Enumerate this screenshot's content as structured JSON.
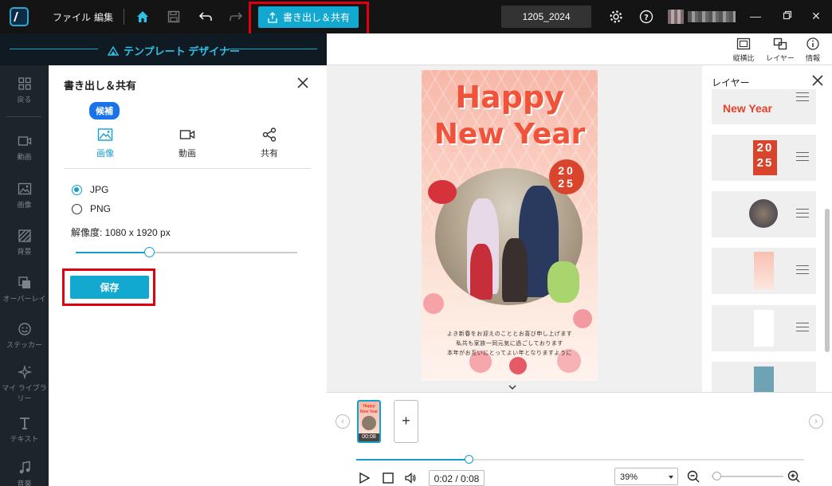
{
  "menu": {
    "file": "ファイル",
    "edit": "編集"
  },
  "toolbar": {
    "export_share": "書き出し＆共有"
  },
  "project": {
    "name": "1205_2024"
  },
  "designer": {
    "title": "テンプレート デザイナー"
  },
  "sidebar": {
    "items": [
      {
        "label": "戻る",
        "icon": "grid-icon"
      },
      {
        "label": "動画",
        "icon": "video-icon"
      },
      {
        "label": "画像",
        "icon": "image-icon"
      },
      {
        "label": "背景",
        "icon": "background-icon"
      },
      {
        "label": "オーバーレイ",
        "icon": "overlay-icon"
      },
      {
        "label": "ステッカー",
        "icon": "sticker-icon"
      },
      {
        "label": "マイ ライブラリー",
        "icon": "sparkle-icon"
      },
      {
        "label": "テキスト",
        "icon": "text-icon"
      },
      {
        "label": "音楽",
        "icon": "music-icon"
      }
    ]
  },
  "export_panel": {
    "title": "書き出し＆共有",
    "badge": "候補",
    "tabs": [
      {
        "label": "画像",
        "active": true
      },
      {
        "label": "動画",
        "active": false
      },
      {
        "label": "共有",
        "active": false
      }
    ],
    "formats": [
      {
        "label": "JPG",
        "checked": true
      },
      {
        "label": "PNG",
        "checked": false
      }
    ],
    "resolution_label": "解像度: 1080 x 1920 px",
    "resolution_level": 0.33,
    "save_label": "保存"
  },
  "canvas_tools": [
    {
      "label": "縦横比",
      "icon": "aspect-ratio-icon"
    },
    {
      "label": "レイヤー",
      "icon": "layers-icon"
    },
    {
      "label": "情報",
      "icon": "info-icon"
    }
  ],
  "card": {
    "line1": "Happy",
    "line2": "New Year",
    "year_top": "20",
    "year_bottom": "25",
    "message": [
      "よき新春をお迎えのこととお喜び申し上げます",
      "私共も家族一同元気に過ごしております",
      "本年がお互いにとってよい年となりますように"
    ]
  },
  "layers": {
    "title": "レイヤー",
    "items": [
      {
        "text": "New Year"
      },
      {
        "text_top": "20",
        "text_bottom": "25"
      },
      {
        "kind": "photo"
      },
      {
        "kind": "background"
      },
      {
        "kind": "white"
      },
      {
        "kind": "blue"
      }
    ]
  },
  "timeline": {
    "clip_line1": "Happy",
    "clip_line2": "New Year",
    "clip_time": "00:08",
    "add": "+",
    "progress": 0.25,
    "time": "0:02 / 0:08",
    "zoom": "39%",
    "zoom_level": 0.03
  },
  "colors": {
    "accent": "#13a8d0",
    "highlight": "#e0000e",
    "card_text": "#f0523a"
  }
}
